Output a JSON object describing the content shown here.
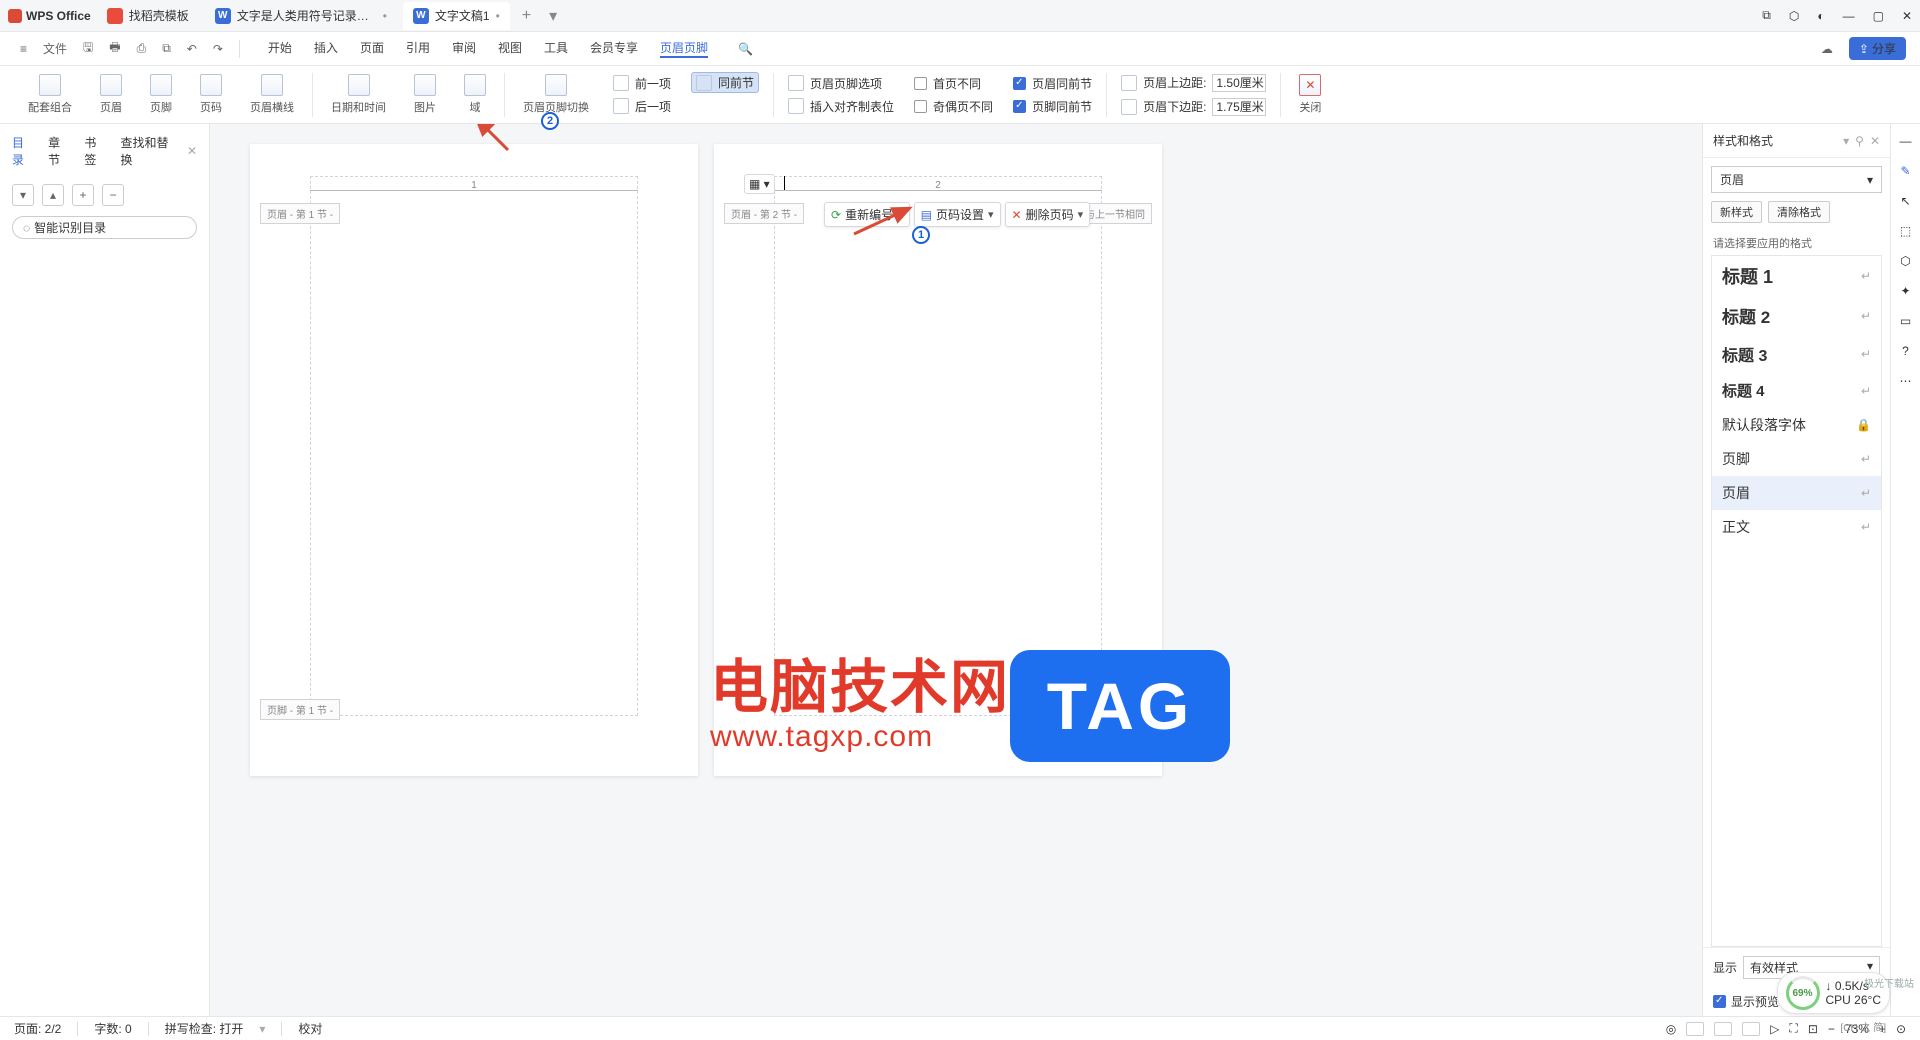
{
  "title_bar": {
    "app_name": "WPS Office",
    "tabs": [
      {
        "label": "找稻壳模板",
        "badge": "r"
      },
      {
        "label": "文字是人类用符号记录表达信息以",
        "badge": "w",
        "dirty": true
      },
      {
        "label": "文字文稿1",
        "badge": "w",
        "dirty": true,
        "active": true
      }
    ],
    "add": "+"
  },
  "menu": {
    "file": "文件",
    "tabs": [
      "开始",
      "插入",
      "页面",
      "引用",
      "审阅",
      "视图",
      "工具",
      "会员专享",
      "页眉页脚"
    ],
    "active_tab": "页眉页脚",
    "share": "分享"
  },
  "ribbon": {
    "groups_main": [
      {
        "label": "配套组合"
      },
      {
        "label": "页眉"
      },
      {
        "label": "页脚"
      },
      {
        "label": "页码"
      },
      {
        "label": "页眉横线"
      }
    ],
    "groups_insert": [
      {
        "label": "日期和时间"
      },
      {
        "label": "图片"
      },
      {
        "label": "域"
      }
    ],
    "switch": "页眉页脚切换",
    "nav": {
      "prev": "前一项",
      "next": "后一项",
      "same": "同前节"
    },
    "options": {
      "hdr_ftr_opts": "页眉页脚选项",
      "align_tab": "插入对齐制表位",
      "first_diff": "首页不同",
      "odd_even_diff": "奇偶页不同",
      "hdr_same": "页眉同前节",
      "ftr_same": "页脚同前节",
      "hdr_top": "页眉上边距:",
      "ftr_bot": "页眉下边距:",
      "hdr_top_val": "1.50厘米",
      "ftr_bot_val": "1.75厘米"
    },
    "close": "关闭"
  },
  "left_panel": {
    "tabs": [
      "目录",
      "章节",
      "书签",
      "查找和替换"
    ],
    "active": "目录",
    "smart": "智能识别目录"
  },
  "pages": {
    "p1": {
      "hdr_tag": "页眉 - 第 1 节 -",
      "ftr_tag": "页脚 - 第 1 节 -",
      "num": "1"
    },
    "p2": {
      "hdr_tag": "页眉 - 第 2 节 -",
      "num": "2",
      "same": "与上一节相同"
    }
  },
  "header_toolbar": {
    "opts": "▦ ▾",
    "renumber": "重新编号",
    "page_setup": "页码设置",
    "delete": "删除页码"
  },
  "style_panel": {
    "title": "样式和格式",
    "current": "页眉",
    "new_style": "新样式",
    "clear": "清除格式",
    "choose_lbl": "请选择要应用的格式",
    "list": [
      {
        "name": "标题 1",
        "cls": "h1"
      },
      {
        "name": "标题 2",
        "cls": "h2"
      },
      {
        "name": "标题 3",
        "cls": "h3"
      },
      {
        "name": "标题 4",
        "cls": "h4"
      },
      {
        "name": "默认段落字体",
        "lock": true
      },
      {
        "name": "页脚"
      },
      {
        "name": "页眉",
        "sel": true
      },
      {
        "name": "正文"
      }
    ],
    "show_lbl": "显示",
    "show_val": "有效样式",
    "preview": "显示预览"
  },
  "status": {
    "page": "页面: 2/2",
    "words": "字数: 0",
    "spell": "拼写检查: 打开",
    "proof": "校对",
    "zoom": "73%"
  },
  "widgets": {
    "cpu_pct": "69%",
    "net": "0.5K/s",
    "cpu_temp": "CPU 26°C",
    "ime": "[CH 之 简]",
    "dl": "极光下载站"
  },
  "watermark": {
    "line1": "电脑技术网",
    "url": "www.tagxp.com",
    "tag": "TAG"
  },
  "annotations": {
    "n1": "1",
    "n2": "2"
  }
}
